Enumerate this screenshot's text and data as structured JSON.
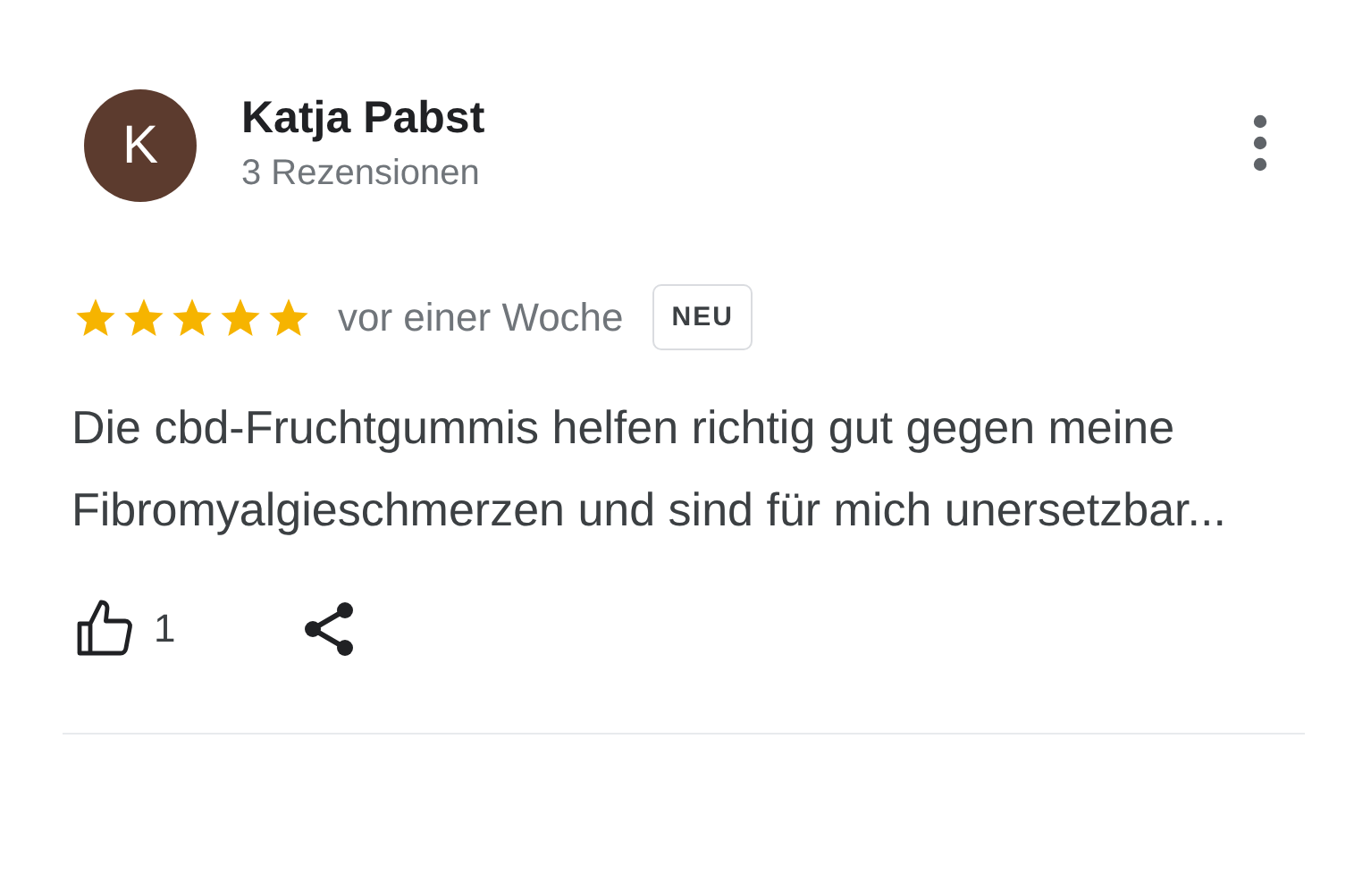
{
  "review": {
    "avatar_letter": "K",
    "author": "Katja Pabst",
    "author_meta": "3 Rezensionen",
    "stars": 5,
    "time": "vor einer Woche",
    "badge": "NEU",
    "text": "Die cbd-Fruchtgummis helfen richtig gut gegen meine Fibromyalgieschmerzen und sind für mich unersetzbar...",
    "likes": "1"
  }
}
